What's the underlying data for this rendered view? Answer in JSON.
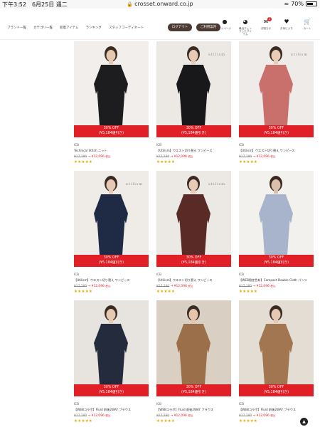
{
  "status_bar": {
    "time_date": "下午3:52　6月25日 週二",
    "url": "crosset.onward.co.jp",
    "battery": "70%",
    "battery_level": 0.7
  },
  "nav": {
    "links": [
      "ブランド一覧",
      "カテゴリ一覧",
      "新着アイテム",
      "ランキング",
      "スタッフコーディネート"
    ],
    "logout_label": "ログアウト",
    "guide_label": "ご利用案内",
    "icons": [
      {
        "icon": "person-icon",
        "label": "マイページ"
      },
      {
        "icon": "eye-icon",
        "label": "最近チェックしたアイテム"
      },
      {
        "icon": "message-icon",
        "label": "お知らせ",
        "badge": "1"
      },
      {
        "icon": "heart-icon",
        "label": "お気に入り"
      },
      {
        "icon": "cart-icon",
        "label": "カート"
      }
    ]
  },
  "products": [
    {
      "maker": "ICB",
      "name": "Technical Stitch ニット",
      "original_price": "¥17,280",
      "sale_price": "¥12,096",
      "tax": "税込",
      "discount": "30% OFF",
      "discount_amount": "(¥5,184値引き)",
      "stars": "★★★★★",
      "rating": 5,
      "garment_color": "#1d1c1e",
      "bg": "#f1eeeb",
      "skin": "#e6c8b0",
      "brandmark": ""
    },
    {
      "maker": "ICB",
      "name": "【Utilism】ウエスト切り替え ワンピース",
      "original_price": "¥17,280",
      "sale_price": "¥12,096",
      "tax": "税込",
      "discount": "30% OFF",
      "discount_amount": "(¥5,184値引き)",
      "stars": "★★★★★",
      "rating": 4.5,
      "garment_color": "#18181b",
      "bg": "#ece9e5",
      "skin": "#e7cbb6",
      "brandmark": "utilism"
    },
    {
      "maker": "ICB",
      "name": "【Utilism】ウエスト切り替え ワンピース",
      "original_price": "¥17,280",
      "sale_price": "¥12,096",
      "tax": "税込",
      "discount": "30% OFF",
      "discount_amount": "(¥5,184値引き)",
      "stars": "★★★★★",
      "rating": 4.5,
      "garment_color": "#c9706c",
      "bg": "#eeebe8",
      "skin": "#e9cdb8",
      "brandmark": "utilism"
    },
    {
      "maker": "ICB",
      "name": "【Utilism】ウエスト切り替え ワンピース",
      "original_price": "¥17,280",
      "sale_price": "¥12,096",
      "tax": "税込",
      "discount": "30% OFF",
      "discount_amount": "(¥5,184値引き)",
      "stars": "★★★★★",
      "rating": 4.5,
      "garment_color": "#1f2a44",
      "bg": "#efece8",
      "skin": "#e6c9b3",
      "brandmark": "utilism"
    },
    {
      "maker": "ICB",
      "name": "【Utilism】ウエスト切り替え ワンピース",
      "original_price": "¥17,280",
      "sale_price": "¥12,096",
      "tax": "税込",
      "discount": "30% OFF",
      "discount_amount": "(¥5,184値引き)",
      "stars": "★★★★★",
      "rating": 4.5,
      "garment_color": "#5a2a26",
      "bg": "#ece9e4",
      "skin": "#e8cbb5",
      "brandmark": "utilism"
    },
    {
      "maker": "ICB",
      "name": "【WEB限定色有】Compact Double Cloth パンツ",
      "original_price": "¥17,280",
      "sale_price": "¥12,096",
      "tax": "税込",
      "discount": "30% OFF",
      "discount_amount": "(¥5,184値引き)",
      "stars": "★★★★★",
      "rating": 4.5,
      "garment_color": "#a8b3cc",
      "bg": "#f3f1ee",
      "skin": "#d8c0ad",
      "brandmark": ""
    },
    {
      "maker": "ICB",
      "name": "【WEBコラボ】Fluid 前後2WAY ブラウス",
      "original_price": "¥17,280",
      "sale_price": "¥12,096",
      "tax": "税込",
      "discount": "30% OFF",
      "discount_amount": "(¥5,184値引き)",
      "stars": "★★★★★",
      "rating": 4.5,
      "garment_color": "#232b3d",
      "bg": "#e7e3de",
      "skin": "#e6c9b3",
      "brandmark": ""
    },
    {
      "maker": "ICB",
      "name": "【WEBコラボ】Fluid 前後2WAY ブラウス",
      "original_price": "¥17,280",
      "sale_price": "¥12,096",
      "tax": "税込",
      "discount": "30% OFF",
      "discount_amount": "(¥5,184値引き)",
      "stars": "★★★★★",
      "rating": 4.5,
      "garment_color": "#9a6f4a",
      "bg": "#d9cfc3",
      "skin": "#e4c6ae",
      "brandmark": ""
    },
    {
      "maker": "ICB",
      "name": "【WEBコラボ】Fluid 前後2WAY ブラウス",
      "original_price": "¥17,280",
      "sale_price": "¥12,096",
      "tax": "税込",
      "discount": "30% OFF",
      "discount_amount": "(¥5,184値引き)",
      "stars": "★★★★★",
      "rating": 4.5,
      "garment_color": "#a17650",
      "bg": "#e4ddd3",
      "skin": "#e6c9b3",
      "brandmark": ""
    }
  ],
  "scroll_top_icon": "chevron-up-icon"
}
